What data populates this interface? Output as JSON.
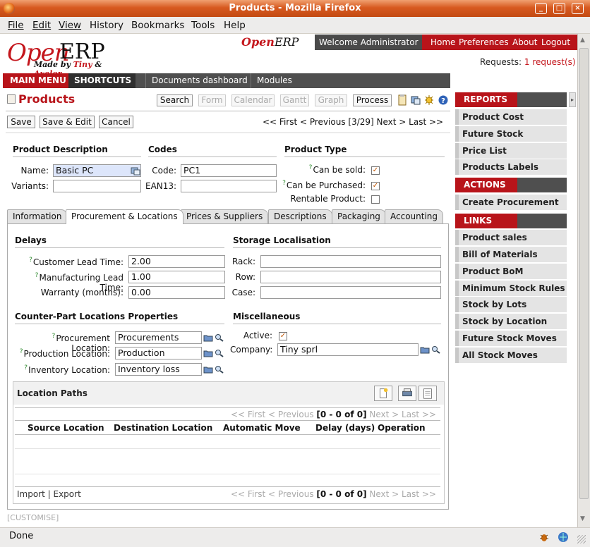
{
  "window": {
    "title": "Products - Mozilla Firefox"
  },
  "menubar": [
    "File",
    "Edit",
    "View",
    "History",
    "Bookmarks",
    "Tools",
    "Help"
  ],
  "header": {
    "logo_open": "Open",
    "logo_erp": "ERP",
    "logo_tagline_prefix": "Made by ",
    "logo_tagline_tiny": "Tiny",
    "logo_tagline_and": " & ",
    "logo_tagline_axelor": "Axelor",
    "small_logo_open": "Open",
    "small_logo_erp": "ERP",
    "welcome": "Welcome Administrator",
    "links": [
      "Home",
      "Preferences",
      "About",
      "Logout"
    ],
    "requests_label": "Requests:",
    "requests_link": "1 request(s)"
  },
  "nav": {
    "main_menu": "MAIN MENU",
    "shortcuts": "SHORTCUTS",
    "items": [
      "Documents dashboard",
      "Modules"
    ]
  },
  "page": {
    "title": "Products",
    "views": {
      "search": "Search",
      "form": "Form",
      "calendar": "Calendar",
      "gantt": "Gantt",
      "graph": "Graph",
      "process": "Process"
    },
    "actions": {
      "save": "Save",
      "save_edit": "Save & Edit",
      "cancel": "Cancel"
    },
    "pager": "<< First < Previous [3/29] Next > Last >>"
  },
  "form": {
    "product_description": "Product Description",
    "name_label": "Name:",
    "name_value": "Basic PC",
    "variants_label": "Variants:",
    "variants_value": "",
    "codes": "Codes",
    "code_label": "Code:",
    "code_value": "PC1",
    "ean13_label": "EAN13:",
    "ean13_value": "",
    "product_type": "Product Type",
    "can_be_sold": "Can be sold:",
    "can_be_sold_value": true,
    "can_be_purchased": "Can be Purchased:",
    "can_be_purchased_value": true,
    "rentable": "Rentable Product:",
    "rentable_value": false,
    "help_mark": "?"
  },
  "tabs": [
    "Information",
    "Procurement & Locations",
    "Prices & Suppliers",
    "Descriptions",
    "Packaging",
    "Accounting"
  ],
  "active_tab": 1,
  "procurement": {
    "delays": "Delays",
    "customer_lead_label": "Customer Lead Time:",
    "customer_lead_value": "2.00",
    "manufacturing_lead_label": "Manufacturing Lead Time:",
    "manufacturing_lead_value": "1.00",
    "warranty_label": "Warranty (months):",
    "warranty_value": "0.00",
    "storage": "Storage Localisation",
    "rack_label": "Rack:",
    "rack_value": "",
    "row_label": "Row:",
    "row_value": "",
    "case_label": "Case:",
    "case_value": "",
    "counterpart": "Counter-Part Locations Properties",
    "proc_loc_label": "Procurement Location:",
    "proc_loc_value": "Procurements",
    "prod_loc_label": "Production Location:",
    "prod_loc_value": "Production",
    "inv_loc_label": "Inventory Location:",
    "inv_loc_value": "Inventory loss",
    "misc": "Miscellaneous",
    "active_label": "Active:",
    "active_value": true,
    "company_label": "Company:",
    "company_value": "Tiny sprl"
  },
  "location_paths": {
    "title": "Location Paths",
    "pager_first": "<< First < Previous ",
    "pager_count": "[0 - 0 of 0]",
    "pager_last": " Next > Last >>",
    "columns": [
      "Source Location",
      "Destination Location",
      "Automatic Move",
      "Delay (days)",
      "Operation"
    ],
    "import_export": "Import | Export"
  },
  "sidebar": {
    "reports_title": "REPORTS",
    "reports": [
      "Product Cost Structure",
      "Future Stock Forecast",
      "Price List",
      "Products Labels"
    ],
    "actions_title": "ACTIONS",
    "actions": [
      "Create Procurement"
    ],
    "links_title": "LINKS",
    "links": [
      "Product sales",
      "Bill of Materials",
      "Product BoM Structure",
      "Minimum Stock Rules",
      "Stock by Lots",
      "Stock by Location",
      "Future Stock Moves",
      "All Stock Moves"
    ]
  },
  "customise": "[CUSTOMISE]",
  "status": "Done",
  "colors": {
    "brand_red": "#b8141a",
    "dark_gray": "#4f4f4f",
    "required_field": "#dde6fb",
    "check_orange": "#c15400"
  }
}
